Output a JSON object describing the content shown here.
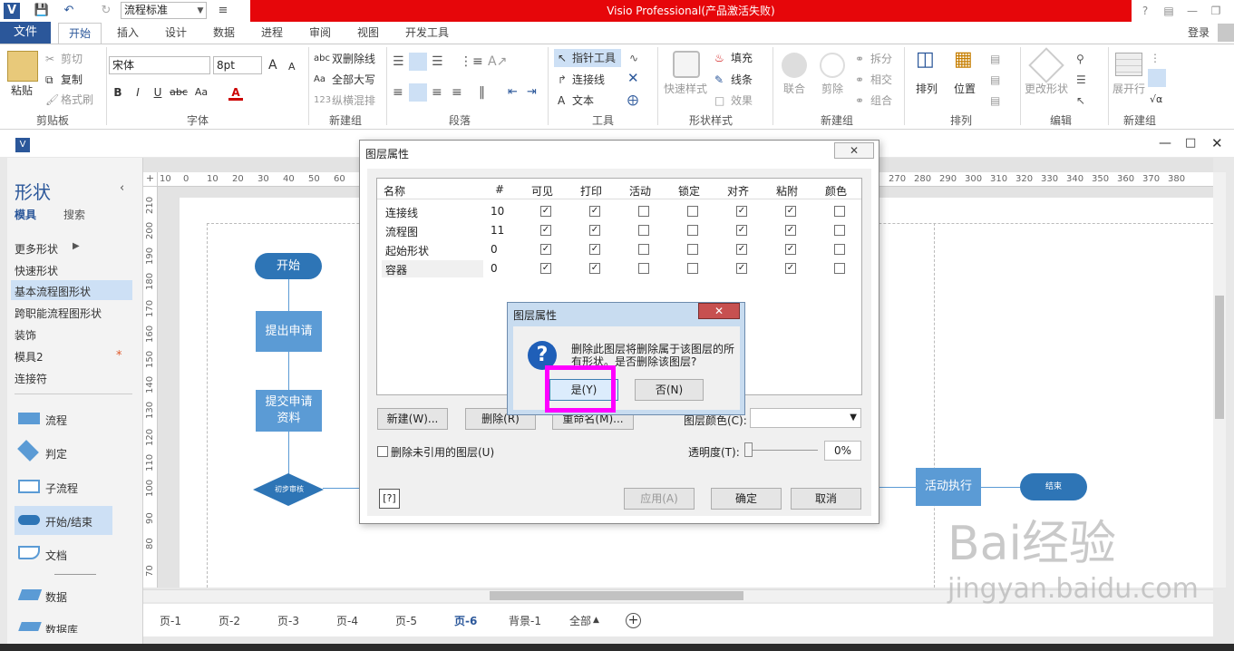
{
  "window": {
    "title": "Visio Professional(产品激活失败)",
    "style_select": "流程标准",
    "login": "登录"
  },
  "tabs": [
    "文件",
    "开始",
    "插入",
    "设计",
    "数据",
    "进程",
    "审阅",
    "视图",
    "开发工具"
  ],
  "ribbon": {
    "clipboard": {
      "paste": "粘贴",
      "cut": "剪切",
      "copy": "复制",
      "format_painter": "格式刷",
      "label": "剪贴板"
    },
    "font": {
      "name": "宋体",
      "size": "8pt",
      "label": "字体",
      "grow": "A",
      "shrink": "A",
      "bold": "B",
      "italic": "I",
      "underline": "U",
      "strike": "abc",
      "case": "Aa",
      "color": "A"
    },
    "newgroup1": {
      "double_strike": "双删除线",
      "all_caps": "全部大写",
      "vertical": "纵横混排",
      "label": "新建组"
    },
    "paragraph": {
      "label": "段落"
    },
    "tools": {
      "pointer": "指针工具",
      "connector": "连接线",
      "text": "文本",
      "label": "工具"
    },
    "shape_styles": {
      "quick": "快速样式",
      "fill": "填充",
      "line": "线条",
      "effects": "效果",
      "label": "形状样式"
    },
    "newgroup2": {
      "union": "联合",
      "fragment": "剪除",
      "split": "拆分",
      "intersect": "相交",
      "combine": "组合",
      "label": "新建组"
    },
    "arrange": {
      "arrange": "排列",
      "position": "位置",
      "label": "排列"
    },
    "edit": {
      "change_shape": "更改形状",
      "label": "编辑"
    },
    "newgroup3": {
      "expand": "展开行",
      "label": "新建组"
    }
  },
  "shapes_panel": {
    "title": "形状",
    "tab_stencils": "模具",
    "tab_search": "搜索",
    "items": [
      "更多形状",
      "快速形状",
      "基本流程图形状",
      "跨职能流程图形状",
      "装饰",
      "模具2",
      "连接符"
    ],
    "shapes": [
      "流程",
      "判定",
      "子流程",
      "开始/结束",
      "文档",
      "数据",
      "数据库"
    ]
  },
  "ruler": {
    "top": [
      "10",
      "0",
      "10",
      "20",
      "30",
      "40",
      "50",
      "60",
      "270",
      "280",
      "290",
      "300",
      "310",
      "320",
      "330",
      "340",
      "350",
      "360",
      "370",
      "380"
    ],
    "left": [
      "210",
      "200",
      "190",
      "180",
      "170",
      "160",
      "150",
      "140",
      "130",
      "120",
      "110",
      "100",
      "90",
      "80",
      "70"
    ]
  },
  "flowchart": {
    "start": "开始",
    "apply": "提出申请",
    "submit": "提交申请资料",
    "review": "初步审核",
    "execute": "活动执行",
    "end": "结束"
  },
  "page_tabs": [
    "页-1",
    "页-2",
    "页-3",
    "页-4",
    "页-5",
    "页-6",
    "背景-1",
    "全部"
  ],
  "layer_dialog": {
    "title": "图层属性",
    "headers": [
      "名称",
      "#",
      "可见",
      "打印",
      "活动",
      "锁定",
      "对齐",
      "粘附",
      "颜色"
    ],
    "rows": [
      {
        "name": "连接线",
        "count": "10",
        "visible": true,
        "print": true,
        "active": false,
        "lock": false,
        "snap": true,
        "glue": true,
        "color": false
      },
      {
        "name": "流程图",
        "count": "11",
        "visible": true,
        "print": true,
        "active": false,
        "lock": false,
        "snap": true,
        "glue": true,
        "color": false
      },
      {
        "name": "起始形状",
        "count": "0",
        "visible": true,
        "print": true,
        "active": false,
        "lock": false,
        "snap": true,
        "glue": true,
        "color": false
      },
      {
        "name": "容器",
        "count": "0",
        "visible": true,
        "print": true,
        "active": false,
        "lock": false,
        "snap": true,
        "glue": true,
        "color": false
      }
    ],
    "new_btn": "新建(W)...",
    "delete_btn": "删除(R)",
    "rename_btn": "重命名(M)...",
    "layer_color_label": "图层颜色(C):",
    "remove_unref": "删除未引用的图层(U)",
    "transparency_label": "透明度(T):",
    "transparency_value": "0%",
    "apply_btn": "应用(A)",
    "ok_btn": "确定",
    "cancel_btn": "取消"
  },
  "confirm_dialog": {
    "title": "图层属性",
    "message": "删除此图层将删除属于该图层的所有形状。是否删除该图层?",
    "yes_btn": "是(Y)",
    "no_btn": "否(N)"
  },
  "watermark": {
    "brand": "Bai经验",
    "url": "jingyan.baidu.com"
  },
  "colors": {
    "accent": "#2b579a",
    "title_red": "#e6060a",
    "shape_blue": "#5b9bd5",
    "highlight": "#ff00ff"
  }
}
